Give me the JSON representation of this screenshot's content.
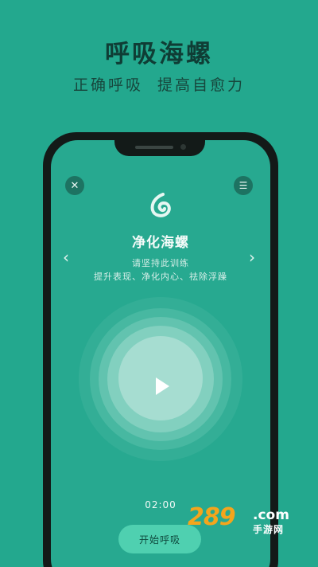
{
  "promo": {
    "title": "呼吸海螺",
    "subtitle": "正确呼吸  提高自愈力"
  },
  "app": {
    "close_glyph": "✕",
    "menu_glyph": "☰",
    "title": "净化海螺",
    "line1": "请坚持此训练",
    "line2": "提升表现、净化内心、祛除浮躁",
    "prev_glyph": "‹",
    "next_glyph": "›",
    "timer": "02:00",
    "start_label": "开始呼吸",
    "icons": [
      "close-icon",
      "menu-icon",
      "conch-logo-icon",
      "chevron-left-icon",
      "chevron-right-icon",
      "play-icon"
    ]
  },
  "watermark": {
    "number": "289",
    "domain": ".com",
    "name": "手游网"
  },
  "colors": {
    "background": "#23a88e",
    "screen": "#27a990",
    "button": "#4fd0b0",
    "watermark_orange": "#f4a51c"
  }
}
